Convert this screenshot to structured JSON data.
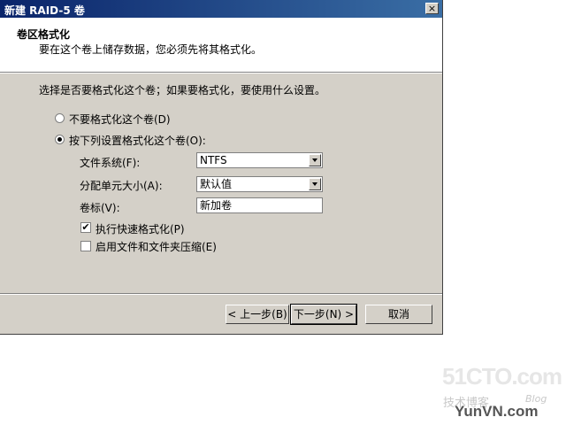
{
  "window": {
    "title": "新建 RAID-5 卷",
    "close_glyph": "×"
  },
  "header": {
    "title": "卷区格式化",
    "subtitle": "要在这个卷上储存数据，您必须先将其格式化。"
  },
  "intro": "选择是否要格式化这个卷；如果要格式化，要使用什么设置。",
  "options": {
    "no_format": "不要格式化这个卷(D)",
    "format": "按下列设置格式化这个卷(O):"
  },
  "fields": {
    "file_system_label": "文件系统(F):",
    "file_system_value": "NTFS",
    "alloc_label": "分配单元大小(A):",
    "alloc_value": "默认值",
    "volume_label_label": "卷标(V):",
    "volume_label_value": "新加卷"
  },
  "checkboxes": {
    "quick_format": "执行快速格式化(P)",
    "compression": "启用文件和文件夹压缩(E)"
  },
  "buttons": {
    "back": "< 上一步(B)",
    "next": "下一步(N) >",
    "cancel": "取消"
  },
  "watermark": {
    "site": "51CTO.com",
    "tagline": "技术博客",
    "blog": "Blog",
    "domain": "YunVN.com"
  }
}
